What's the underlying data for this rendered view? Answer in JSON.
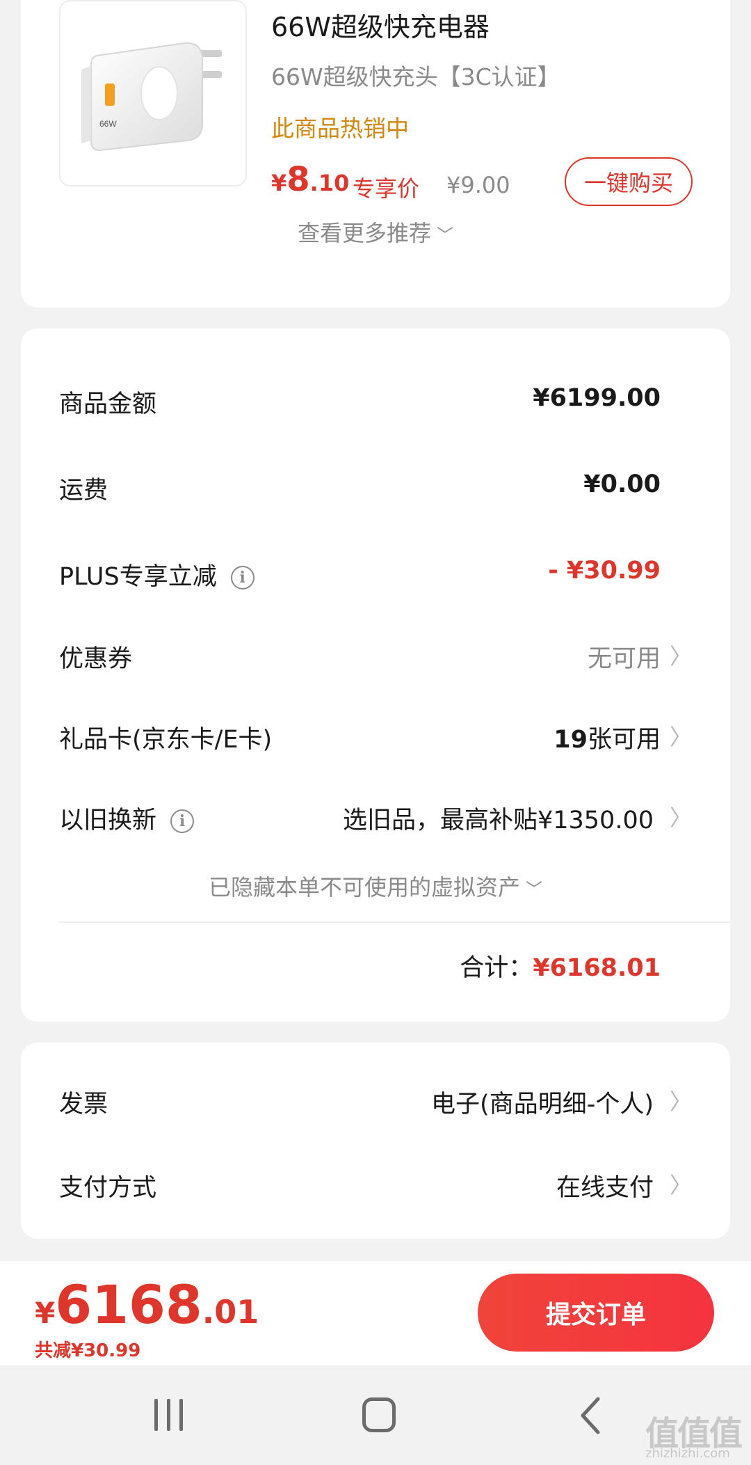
{
  "product": {
    "title": "66W超级快充电器",
    "subtitle": "66W超级快充头【3C认证】",
    "hot_tag": "此商品热销中",
    "price_currency": "¥",
    "price_int": "8",
    "price_dec": ".10",
    "member_label": "专享价",
    "original_price": "¥9.00",
    "buy_button": "一键购买",
    "charger_label": "66W",
    "more_recommend": "查看更多推荐"
  },
  "amount": {
    "rows": [
      {
        "label": "商品金额",
        "value": "¥6199.00"
      },
      {
        "label": "运费",
        "value": "¥0.00"
      },
      {
        "label": "PLUS专享立减",
        "value": "- ¥30.99"
      },
      {
        "label": "优惠券",
        "value": "无可用"
      },
      {
        "label": "礼品卡(京东卡/E卡)",
        "value_count": "19",
        "value_suffix": "张可用"
      },
      {
        "label": "以旧换新",
        "value": "选旧品，最高补贴¥1350.00"
      }
    ],
    "hidden_assets": "已隐藏本单不可使用的虚拟资产",
    "total_label": "合计：",
    "total_value": "¥6168.01"
  },
  "invoice": {
    "rows": [
      {
        "label": "发票",
        "value": "电子(商品明细-个人)"
      },
      {
        "label": "支付方式",
        "value": "在线支付"
      }
    ]
  },
  "bottom": {
    "currency": "¥",
    "price_int": "6168",
    "price_dec": ".01",
    "saved": "共减¥30.99",
    "submit": "提交订单"
  },
  "watermark": {
    "main": "值值值",
    "sub": "zhizhizhi.com"
  },
  "colors": {
    "accent_red": "#e0352b",
    "hot_orange": "#d4870a",
    "muted_gray": "#8a8a8a"
  }
}
